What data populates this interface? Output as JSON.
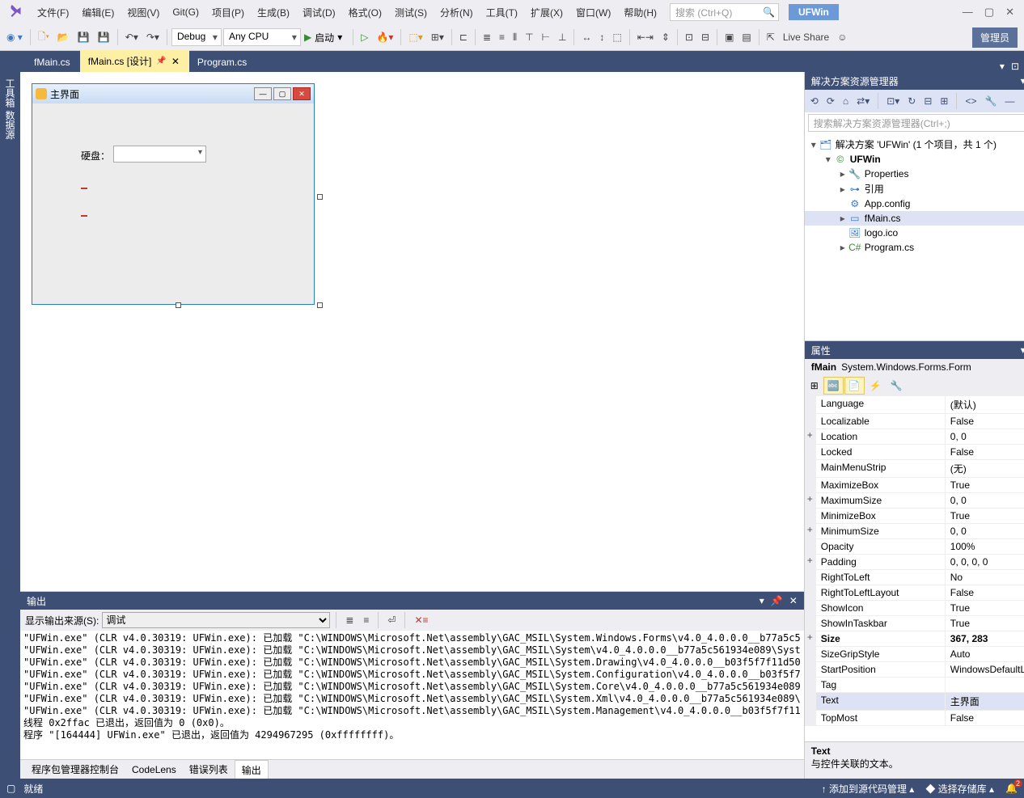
{
  "title_project": "UFWin",
  "menu": [
    "文件(F)",
    "编辑(E)",
    "视图(V)",
    "Git(G)",
    "项目(P)",
    "生成(B)",
    "调试(D)",
    "格式(O)",
    "测试(S)",
    "分析(N)",
    "工具(T)",
    "扩展(X)",
    "窗口(W)",
    "帮助(H)"
  ],
  "search_placeholder": "搜索 (Ctrl+Q)",
  "admin_label": "管理员",
  "toolbar": {
    "config": "Debug",
    "platform": "Any CPU",
    "run": "启动",
    "liveshare": "Live Share"
  },
  "tabs": [
    {
      "label": "fMain.cs",
      "active": false
    },
    {
      "label": "fMain.cs [设计]",
      "active": true,
      "pinned": true
    },
    {
      "label": "Program.cs",
      "active": false
    }
  ],
  "side_tab": "工具箱 数据源",
  "form": {
    "title": "主界面",
    "label": "硬盘："
  },
  "output": {
    "title": "输出",
    "source_label": "显示输出来源(S):",
    "source": "调试",
    "lines": [
      "\"UFWin.exe\" (CLR v4.0.30319: UFWin.exe): 已加载 \"C:\\WINDOWS\\Microsoft.Net\\assembly\\GAC_MSIL\\System.Windows.Forms\\v4.0_4.0.0.0__b77a5c5",
      "\"UFWin.exe\" (CLR v4.0.30319: UFWin.exe): 已加载 \"C:\\WINDOWS\\Microsoft.Net\\assembly\\GAC_MSIL\\System\\v4.0_4.0.0.0__b77a5c561934e089\\Syst",
      "\"UFWin.exe\" (CLR v4.0.30319: UFWin.exe): 已加载 \"C:\\WINDOWS\\Microsoft.Net\\assembly\\GAC_MSIL\\System.Drawing\\v4.0_4.0.0.0__b03f5f7f11d50",
      "\"UFWin.exe\" (CLR v4.0.30319: UFWin.exe): 已加载 \"C:\\WINDOWS\\Microsoft.Net\\assembly\\GAC_MSIL\\System.Configuration\\v4.0_4.0.0.0__b03f5f7",
      "\"UFWin.exe\" (CLR v4.0.30319: UFWin.exe): 已加载 \"C:\\WINDOWS\\Microsoft.Net\\assembly\\GAC_MSIL\\System.Core\\v4.0_4.0.0.0__b77a5c561934e089",
      "\"UFWin.exe\" (CLR v4.0.30319: UFWin.exe): 已加载 \"C:\\WINDOWS\\Microsoft.Net\\assembly\\GAC_MSIL\\System.Xml\\v4.0_4.0.0.0__b77a5c561934e089\\",
      "\"UFWin.exe\" (CLR v4.0.30319: UFWin.exe): 已加载 \"C:\\WINDOWS\\Microsoft.Net\\assembly\\GAC_MSIL\\System.Management\\v4.0_4.0.0.0__b03f5f7f11",
      "线程 0x2ffac 已退出，返回值为 0 (0x0)。",
      "程序 \"[164444] UFWin.exe\" 已退出，返回值为 4294967295 (0xffffffff)。"
    ]
  },
  "bottom_tabs": [
    "程序包管理器控制台",
    "CodeLens",
    "错误列表",
    "输出"
  ],
  "bottom_active": "输出",
  "solution": {
    "title": "解决方案资源管理器",
    "search_placeholder": "搜索解决方案资源管理器(Ctrl+;)",
    "root": "解决方案 'UFWin' (1 个项目，共 1 个)",
    "tree": [
      {
        "depth": 0,
        "exp": "▾",
        "icon": "sln",
        "label": "解决方案 'UFWin' (1 个项目，共 1 个)"
      },
      {
        "depth": 1,
        "exp": "▾",
        "icon": "csproj",
        "label": "UFWin",
        "bold": true
      },
      {
        "depth": 2,
        "exp": "▸",
        "icon": "wrench",
        "label": "Properties"
      },
      {
        "depth": 2,
        "exp": "▸",
        "icon": "refs",
        "label": "引用"
      },
      {
        "depth": 2,
        "exp": "",
        "icon": "config",
        "label": "App.config"
      },
      {
        "depth": 2,
        "exp": "▸",
        "icon": "form",
        "label": "fMain.cs",
        "selected": true
      },
      {
        "depth": 2,
        "exp": "",
        "icon": "ico",
        "label": "logo.ico"
      },
      {
        "depth": 2,
        "exp": "▸",
        "icon": "cs",
        "label": "Program.cs"
      }
    ]
  },
  "props": {
    "title": "属性",
    "object_name": "fMain",
    "object_type": "System.Windows.Forms.Form",
    "rows": [
      {
        "exp": "",
        "name": "Language",
        "val": "(默认)"
      },
      {
        "exp": "",
        "name": "Localizable",
        "val": "False"
      },
      {
        "exp": "+",
        "name": "Location",
        "val": "0, 0"
      },
      {
        "exp": "",
        "name": "Locked",
        "val": "False"
      },
      {
        "exp": "",
        "name": "MainMenuStrip",
        "val": "(无)"
      },
      {
        "exp": "",
        "name": "MaximizeBox",
        "val": "True"
      },
      {
        "exp": "+",
        "name": "MaximumSize",
        "val": "0, 0"
      },
      {
        "exp": "",
        "name": "MinimizeBox",
        "val": "True"
      },
      {
        "exp": "+",
        "name": "MinimumSize",
        "val": "0, 0"
      },
      {
        "exp": "",
        "name": "Opacity",
        "val": "100%"
      },
      {
        "exp": "+",
        "name": "Padding",
        "val": "0, 0, 0, 0"
      },
      {
        "exp": "",
        "name": "RightToLeft",
        "val": "No"
      },
      {
        "exp": "",
        "name": "RightToLeftLayout",
        "val": "False"
      },
      {
        "exp": "",
        "name": "ShowIcon",
        "val": "True"
      },
      {
        "exp": "",
        "name": "ShowInTaskbar",
        "val": "True"
      },
      {
        "exp": "+",
        "name": "Size",
        "val": "367, 283",
        "bold": true
      },
      {
        "exp": "",
        "name": "SizeGripStyle",
        "val": "Auto"
      },
      {
        "exp": "",
        "name": "StartPosition",
        "val": "WindowsDefaultLocation"
      },
      {
        "exp": "",
        "name": "Tag",
        "val": ""
      },
      {
        "exp": "",
        "name": "Text",
        "val": "主界面",
        "selected": true
      },
      {
        "exp": "",
        "name": "TopMost",
        "val": "False"
      }
    ],
    "desc_name": "Text",
    "desc_text": "与控件关联的文本。"
  },
  "status": {
    "ready": "就绪",
    "add_scm": "添加到源代码管理",
    "select_repo": "选择存储库"
  }
}
